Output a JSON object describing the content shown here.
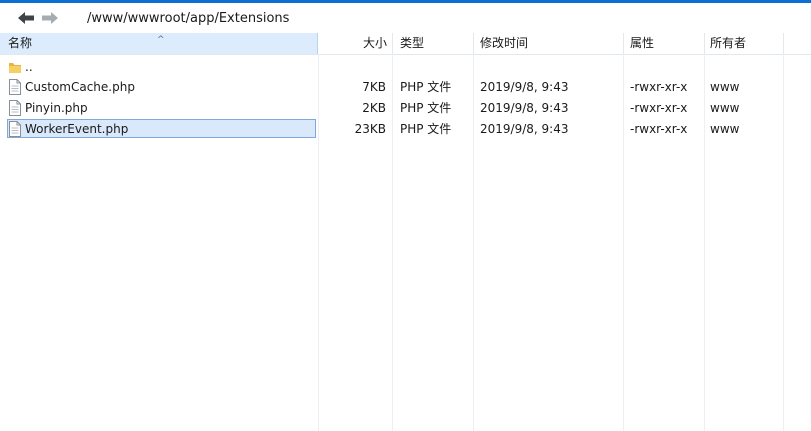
{
  "toolbar": {
    "back_enabled": true,
    "forward_enabled": false,
    "path": "/www/wwwroot/app/Extensions"
  },
  "columns": {
    "name": "名称",
    "size": "大小",
    "type": "类型",
    "modified": "修改时间",
    "attributes": "属性",
    "owner": "所有者"
  },
  "files": [
    {
      "name": "..",
      "icon": "folder-icon",
      "size": "",
      "type": "",
      "modified": "",
      "attributes": "",
      "owner": ""
    },
    {
      "name": "CustomCache.php",
      "icon": "file-icon",
      "size": "7KB",
      "type": "PHP 文件",
      "modified": "2019/9/8, 9:43",
      "attributes": "-rwxr-xr-x",
      "owner": "www"
    },
    {
      "name": "Pinyin.php",
      "icon": "file-icon",
      "size": "2KB",
      "type": "PHP 文件",
      "modified": "2019/9/8, 9:43",
      "attributes": "-rwxr-xr-x",
      "owner": "www"
    },
    {
      "name": "WorkerEvent.php",
      "icon": "file-icon",
      "size": "23KB",
      "type": "PHP 文件",
      "modified": "2019/9/8, 9:43",
      "attributes": "-rwxr-xr-x",
      "owner": "www",
      "selected": true
    }
  ],
  "colors": {
    "accent": "#0b6fd3",
    "header_selected": "#dcecfc",
    "row_selected": "#d9e8fb",
    "folder": "#f2c14e"
  }
}
